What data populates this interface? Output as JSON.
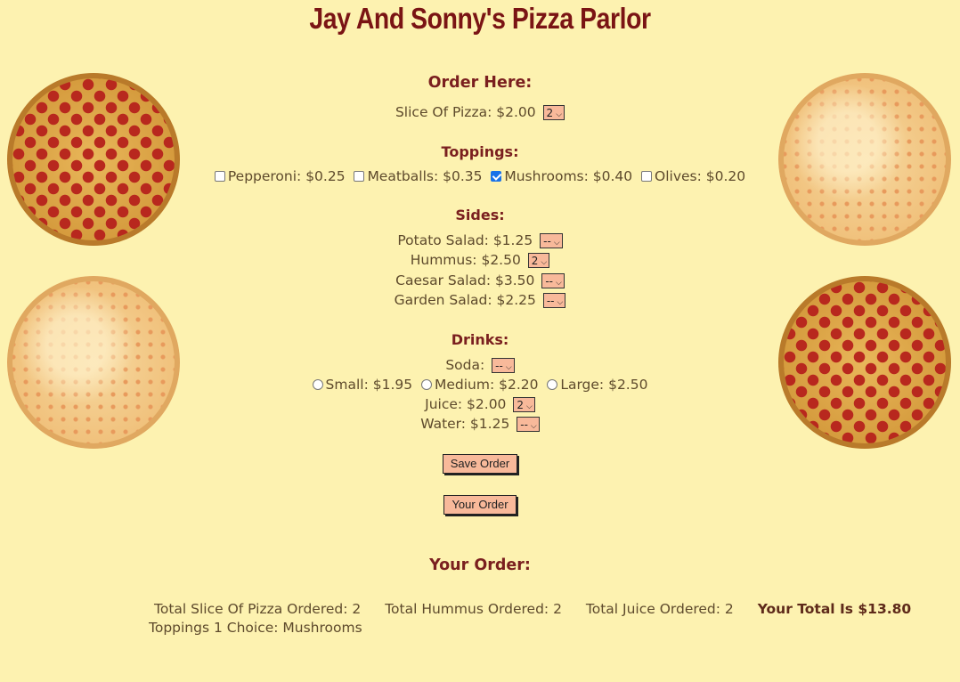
{
  "header": {
    "title": "Jay And Sonny's Pizza Parlor"
  },
  "order": {
    "heading": "Order Here:",
    "slice_label": "Slice Of Pizza: $2.00",
    "slice_qty": "2"
  },
  "toppings": {
    "heading": "Toppings:",
    "items": [
      {
        "label": "Pepperoni: $0.25",
        "checked": false
      },
      {
        "label": "Meatballs: $0.35",
        "checked": false
      },
      {
        "label": "Mushrooms: $0.40",
        "checked": true
      },
      {
        "label": "Olives: $0.20",
        "checked": false
      }
    ]
  },
  "sides": {
    "heading": "Sides:",
    "items": [
      {
        "label": "Potato Salad: $1.25",
        "qty": "--"
      },
      {
        "label": "Hummus: $2.50",
        "qty": "2"
      },
      {
        "label": "Caesar Salad: $3.50",
        "qty": "--"
      },
      {
        "label": "Garden Salad: $2.25",
        "qty": "--"
      }
    ]
  },
  "drinks": {
    "heading": "Drinks:",
    "soda_label": "Soda:",
    "soda_qty": "--",
    "sizes": [
      {
        "label": "Small: $1.95",
        "selected": false
      },
      {
        "label": "Medium: $2.20",
        "selected": false
      },
      {
        "label": "Large: $2.50",
        "selected": false
      }
    ],
    "juice_label": "Juice: $2.00",
    "juice_qty": "2",
    "water_label": "Water: $1.25",
    "water_qty": "--"
  },
  "buttons": {
    "save_label": "Save Order",
    "your_order_label": "Your Order"
  },
  "summary": {
    "heading": "Your Order:",
    "slice_total": "Total Slice Of Pizza Ordered: 2",
    "hummus_total": "Total Hummus Ordered: 2",
    "juice_total": "Total Juice Ordered: 2",
    "grand_total": "Your Total Is $13.80",
    "toppings_line": "Toppings 1 Choice: Mushrooms"
  },
  "colors": {
    "background": "#fdf2b0",
    "title": "#7a1414",
    "heading": "#7a1f1f",
    "control": "#f8b99a"
  },
  "icons": {
    "dropdown": "chevron-down-icon"
  }
}
